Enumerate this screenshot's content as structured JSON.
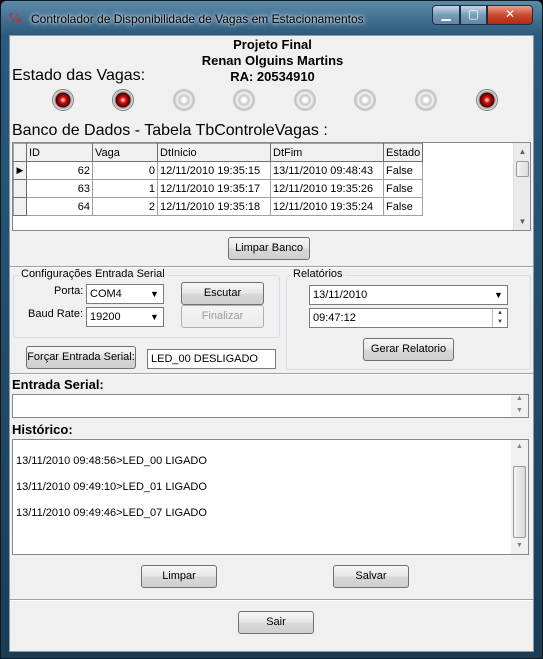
{
  "window": {
    "title": "Controlador de Disponibilidade de Vagas em Estacionamentos",
    "controls": {
      "minimize": "▁",
      "maximize": "▢",
      "close": "✕"
    }
  },
  "header": {
    "line1": "Projeto Final",
    "line2": "Renan Olguins Martins",
    "line3": "RA: 20534910"
  },
  "status": {
    "label": "Estado das Vagas:",
    "leds": [
      {
        "name": "vaga-0",
        "on": true
      },
      {
        "name": "vaga-1",
        "on": true
      },
      {
        "name": "vaga-2",
        "on": false
      },
      {
        "name": "vaga-3",
        "on": false
      },
      {
        "name": "vaga-4",
        "on": false
      },
      {
        "name": "vaga-5",
        "on": false
      },
      {
        "name": "vaga-6",
        "on": false
      },
      {
        "name": "vaga-7",
        "on": true
      }
    ]
  },
  "database": {
    "title": "Banco de Dados - Tabela TbControleVagas :",
    "columns": [
      "ID",
      "Vaga",
      "DtInicio",
      "DtFim",
      "Estado"
    ],
    "rows": [
      [
        "62",
        "0",
        "12/11/2010 19:35:15",
        "13/11/2010 09:48:43",
        "False"
      ],
      [
        "63",
        "1",
        "12/11/2010 19:35:17",
        "12/11/2010 19:35:26",
        "False"
      ],
      [
        "64",
        "2",
        "12/11/2010 19:35:18",
        "12/11/2010 19:35:24",
        "False"
      ]
    ],
    "clear_button": "Limpar Banco"
  },
  "serial_config": {
    "group_label": "Configurações Entrada Serial",
    "port_label": "Porta:",
    "port_value": "COM4",
    "baud_label": "Baud Rate:",
    "baud_value": "19200",
    "listen_button": "Escutar",
    "finish_button": "Finalizar",
    "force_button": "Forçar Entrada Serial:",
    "force_value": "LED_00 DESLIGADO"
  },
  "reports": {
    "group_label": "Relatórios",
    "date_value": "13/11/2010",
    "time_value": "09:47:12",
    "generate_button": "Gerar Relatorio"
  },
  "serial_input": {
    "label": "Entrada Serial:",
    "value": ""
  },
  "history": {
    "label": "Histórico:",
    "lines": [
      "13/11/2010 09:48:56>LED_00 LIGADO",
      "13/11/2010 09:49:10>LED_01 LIGADO",
      "13/11/2010 09:49:46>LED_07 LIGADO"
    ],
    "clear_button": "Limpar",
    "save_button": "Salvar"
  },
  "footer": {
    "exit_button": "Sair"
  }
}
